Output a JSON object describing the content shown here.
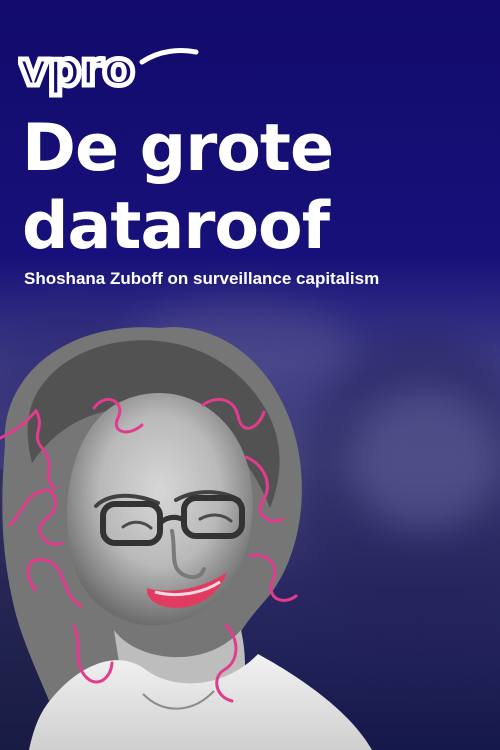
{
  "brand": {
    "logo_text": "vpro"
  },
  "poster": {
    "title_line_1": "De grote",
    "title_line_2": "dataroof",
    "subtitle": "Shoshana Zuboff on surveillance capitalism"
  },
  "colors": {
    "background": "#15106d",
    "text": "#ffffff",
    "accent_pink": "#e33b8e"
  },
  "image": {
    "semantic": "portrait-photo"
  }
}
